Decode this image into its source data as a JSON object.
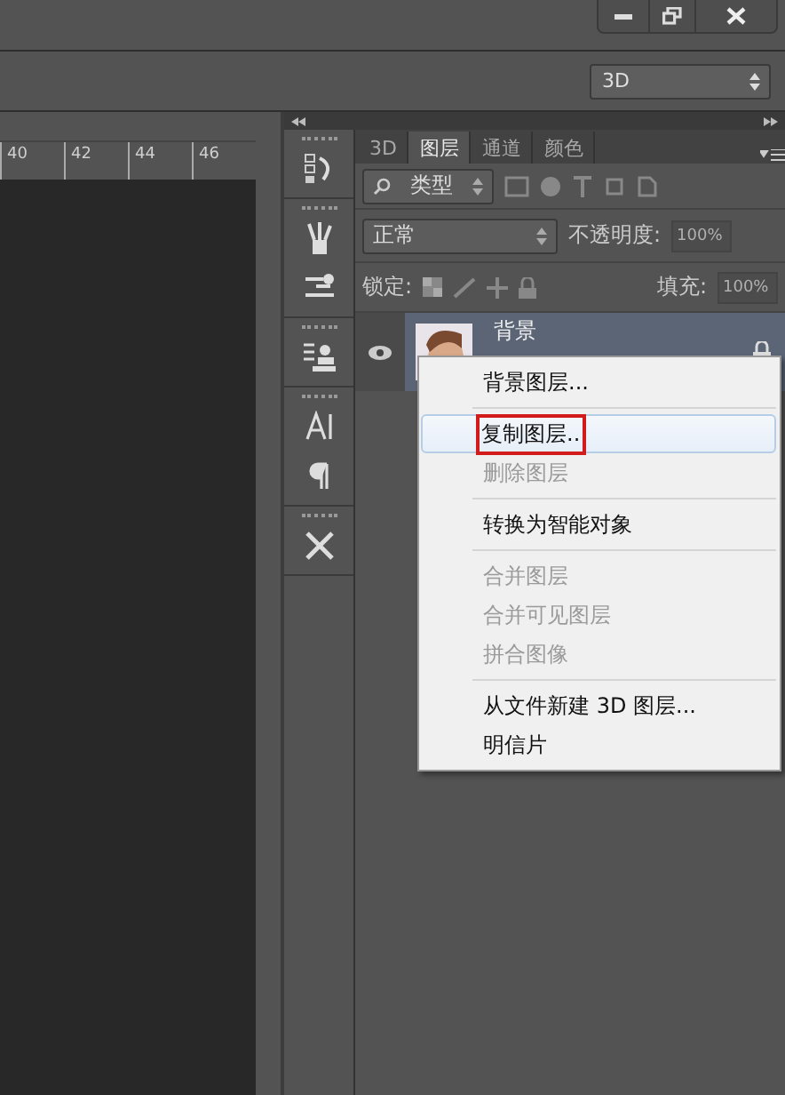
{
  "options_bar": {
    "workspace": "3D"
  },
  "ruler": {
    "ticks": [
      "40",
      "42",
      "44",
      "46"
    ]
  },
  "layers_panel": {
    "tabs": [
      {
        "label": "3D",
        "selected": false
      },
      {
        "label": "图层",
        "selected": true
      },
      {
        "label": "通道",
        "selected": false
      },
      {
        "label": "颜色",
        "selected": false
      }
    ],
    "filter": "类型",
    "blend_mode": "正常",
    "opacity_label": "不透明度:",
    "opacity": "100%",
    "lock_label": "锁定:",
    "fill_label": "填充:",
    "fill": "100%",
    "layers": [
      {
        "name": "背景",
        "visible": true,
        "locked": true,
        "selected": true
      }
    ]
  },
  "context_menu": {
    "items": [
      {
        "kind": "item",
        "label": "背景图层...",
        "disabled": false,
        "selected": false,
        "marked": false
      },
      {
        "kind": "separator"
      },
      {
        "kind": "item",
        "label": "复制图层..",
        "disabled": false,
        "selected": true,
        "marked": true
      },
      {
        "kind": "item",
        "label": "删除图层",
        "disabled": true,
        "selected": false,
        "marked": false
      },
      {
        "kind": "separator"
      },
      {
        "kind": "item",
        "label": "转换为智能对象",
        "disabled": false,
        "selected": false,
        "marked": false
      },
      {
        "kind": "separator"
      },
      {
        "kind": "item",
        "label": "合并图层",
        "disabled": true,
        "selected": false,
        "marked": false
      },
      {
        "kind": "item",
        "label": "合并可见图层",
        "disabled": true,
        "selected": false,
        "marked": false
      },
      {
        "kind": "item",
        "label": "拼合图像",
        "disabled": true,
        "selected": false,
        "marked": false
      },
      {
        "kind": "separator"
      },
      {
        "kind": "item",
        "label": "从文件新建 3D 图层...",
        "disabled": false,
        "selected": false,
        "marked": false
      },
      {
        "kind": "item",
        "label": "明信片",
        "disabled": false,
        "selected": false,
        "marked": false
      }
    ]
  }
}
